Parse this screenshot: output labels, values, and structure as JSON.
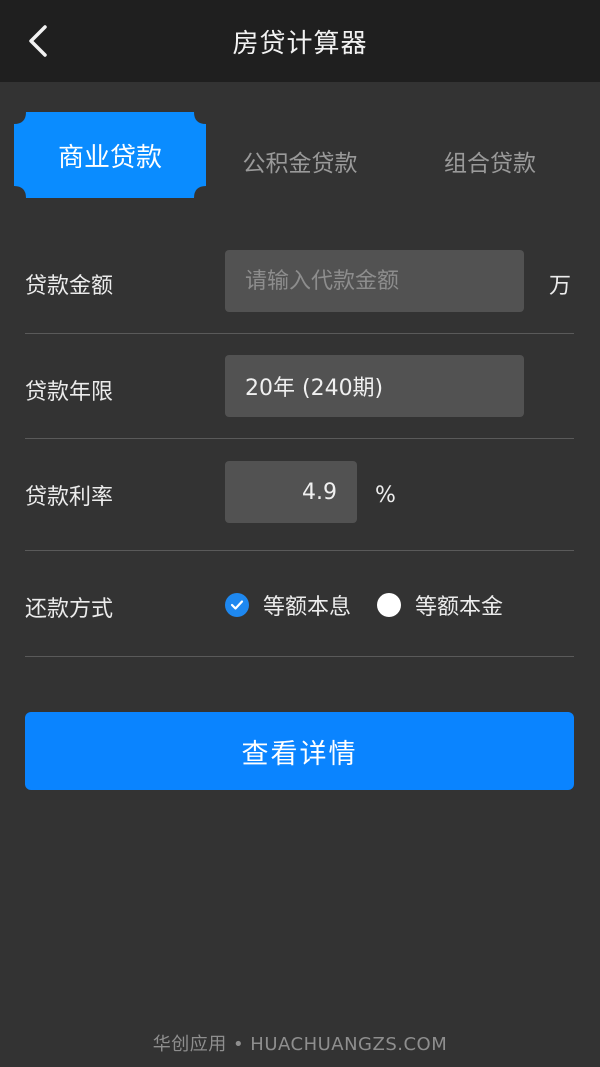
{
  "header": {
    "title": "房贷计算器",
    "back_icon": "chevron-left-icon"
  },
  "tabs": [
    {
      "label": "商业贷款",
      "active": true
    },
    {
      "label": "公积金贷款",
      "active": false
    },
    {
      "label": "组合贷款",
      "active": false
    }
  ],
  "form": {
    "amount": {
      "label": "贷款金额",
      "placeholder": "请输入代款金额",
      "value": "",
      "unit": "万"
    },
    "term": {
      "label": "贷款年限",
      "value": "20年 (240期)"
    },
    "rate": {
      "label": "贷款利率",
      "value": "4.9",
      "unit": "%"
    },
    "repayment": {
      "label": "还款方式",
      "options": [
        {
          "label": "等额本息",
          "checked": true
        },
        {
          "label": "等额本金",
          "checked": false
        }
      ]
    }
  },
  "submit_label": "查看详情",
  "footer_text": "华创应用 • HUACHUANGZS.COM",
  "colors": {
    "accent": "#0a84ff",
    "header_bg": "#1f1f1f",
    "page_bg": "#333333",
    "field_bg": "#525252"
  }
}
